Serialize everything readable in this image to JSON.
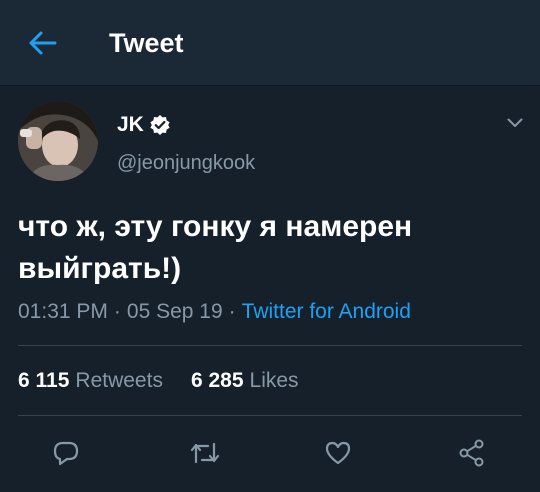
{
  "header": {
    "title": "Tweet",
    "back_icon": "arrow-left-icon",
    "accent_color": "#1da1f2"
  },
  "tweet": {
    "author": {
      "name": "JK",
      "handle": "@jeonjungkook",
      "verified": true,
      "verified_icon": "verified-badge-icon"
    },
    "text_line1": "что ж, эту гонку я намерен",
    "text_line2": "выйграть!)",
    "time": "01:31 PM",
    "separator": "·",
    "date": "05 Sep 19",
    "source": "Twitter for Android",
    "retweets_count": "6 115",
    "retweets_label": "Retweets",
    "likes_count": "6 285",
    "likes_label": "Likes"
  },
  "actions": {
    "reply_icon": "reply-icon",
    "retweet_icon": "retweet-icon",
    "like_icon": "heart-icon",
    "share_icon": "share-icon",
    "more_icon": "chevron-down-icon"
  },
  "colors": {
    "background": "#15202b",
    "header_bg": "#1b2836",
    "secondary_text": "#8899a6",
    "divider": "#38444d",
    "link": "#1da1f2"
  }
}
